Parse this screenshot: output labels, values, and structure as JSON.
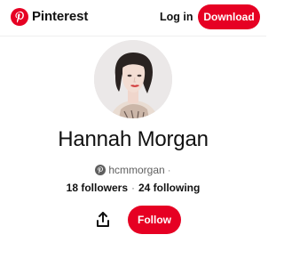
{
  "header": {
    "brand": "Pinterest",
    "login_label": "Log in",
    "download_label": "Download"
  },
  "profile": {
    "name": "Hannah Morgan",
    "handle": "hcmmorgan",
    "handle_separator": "·",
    "followers": "18 followers",
    "following": "24 following",
    "stats_separator": "·",
    "follow_label": "Follow"
  },
  "icons": {
    "logo": "pinterest-logo-icon",
    "handle": "pinterest-badge-icon",
    "share": "share-icon"
  },
  "colors": {
    "accent": "#e60023",
    "text": "#111111",
    "muted": "#5f5f5f"
  }
}
